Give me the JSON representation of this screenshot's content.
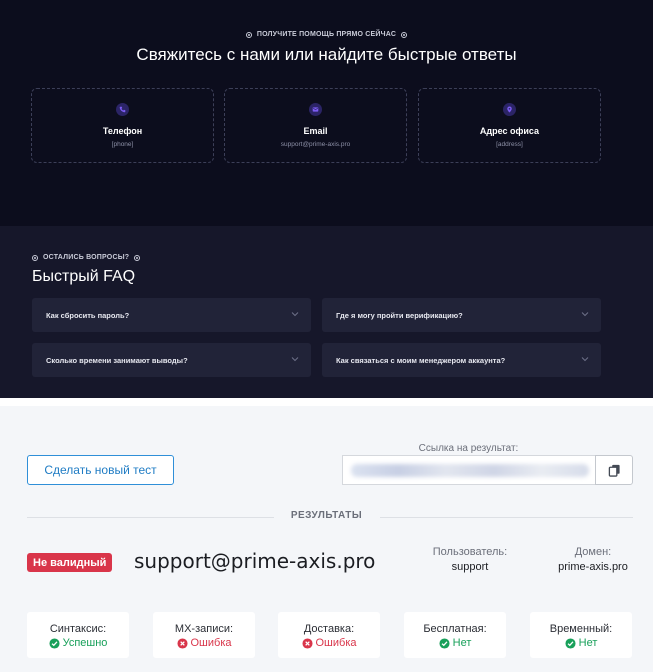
{
  "contact": {
    "eyebrow": "ПОЛУЧИТЕ ПОМОЩЬ ПРЯМО СЕЙЧАС",
    "title": "Свяжитесь с нами или найдите быстрые ответы",
    "cards": [
      {
        "icon": "phone-icon",
        "title": "Телефон",
        "value": "[phone]"
      },
      {
        "icon": "mail-icon",
        "title": "Email",
        "value": "support@prime-axis.pro"
      },
      {
        "icon": "location-pin-icon",
        "title": "Адрес офиса",
        "value": "[address]"
      }
    ],
    "accent": "#7c5cf2"
  },
  "faq": {
    "eyebrow": "ОСТАЛИСЬ ВОПРОСЫ?",
    "title": "Быстрый FAQ",
    "items": [
      {
        "question": "Как сбросить пароль?"
      },
      {
        "question": "Где я могу пройти верификацию?"
      },
      {
        "question": "Сколько времени занимают выводы?"
      },
      {
        "question": "Как связаться с моим менеджером аккаунта?"
      }
    ]
  },
  "results": {
    "new_test_label": "Сделать новый тест",
    "link_label": "Ссылка на результат:",
    "section_label": "РЕЗУЛЬТАТЫ",
    "status_badge": "Не валидный",
    "email": "support@prime-axis.pro",
    "user_label": "Пользователь:",
    "user_value": "support",
    "domain_label": "Домен:",
    "domain_value": "prime-axis.pro",
    "checks": [
      {
        "label": "Синтаксис:",
        "value": "Успешно",
        "status": "ok"
      },
      {
        "label": "MX-записи:",
        "value": "Ошибка",
        "status": "bad"
      },
      {
        "label": "Доставка:",
        "value": "Ошибка",
        "status": "bad"
      },
      {
        "label": "Бесплатная:",
        "value": "Нет",
        "status": "ok"
      },
      {
        "label": "Временный:",
        "value": "Нет",
        "status": "ok"
      }
    ],
    "colors": {
      "ok": "#18a05a",
      "bad": "#d9354a",
      "link": "#1f7cc4"
    }
  }
}
